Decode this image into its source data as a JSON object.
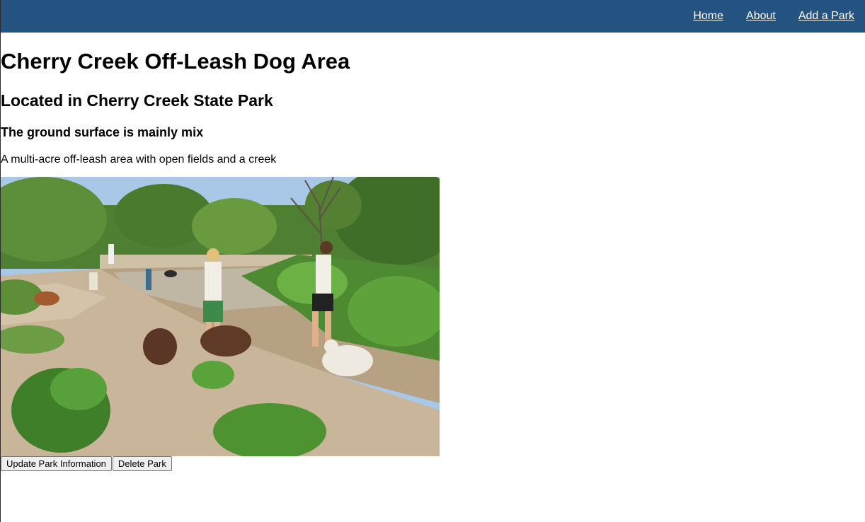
{
  "colors": {
    "navbar_bg": "#245381",
    "nav_text": "#ffffff"
  },
  "nav": {
    "items": [
      {
        "label": "Home"
      },
      {
        "label": "About"
      },
      {
        "label": "Add a Park"
      }
    ]
  },
  "park": {
    "title": "Cherry Creek Off-Leash Dog Area",
    "location": "Located in Cherry Creek State Park",
    "surface": "The ground surface is mainly mix",
    "description": "A multi-acre off-leash area with open fields and a creek"
  },
  "actions": {
    "update_label": "Update Park Information",
    "delete_label": "Delete Park"
  }
}
